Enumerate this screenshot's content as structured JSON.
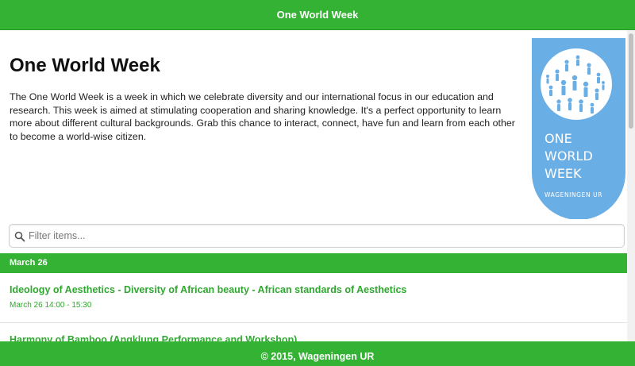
{
  "header": {
    "title": "One World Week"
  },
  "main": {
    "title": "One World Week",
    "intro": "The One World Week is a week in which we celebrate diversity and our international focus in our education and research. This week is aimed at stimulating cooperation and sharing knowledge. It's a perfect opportunity to learn more about different cultural backgrounds. Grab this chance to interact, connect, have fun and learn from each other to become a world-wise citizen."
  },
  "logo": {
    "line1": "ONE",
    "line2": "WORLD",
    "line3": "WEEK",
    "org": "WAGENINGEN UR",
    "color": "#6aaee6"
  },
  "filter": {
    "placeholder": "Filter items..."
  },
  "list": {
    "divider": "March 26",
    "events": [
      {
        "title": "Ideology of Aesthetics - Diversity of African beauty - African standards of Aesthetics",
        "time": "March 26 14:00 - 15:30"
      },
      {
        "title": "Harmony of Bamboo (Angklung Performance and Workshop)"
      }
    ]
  },
  "footer": {
    "text": "© 2015, Wageningen UR"
  },
  "colors": {
    "brand_green": "#33b233",
    "link_green": "#2fa82f"
  }
}
